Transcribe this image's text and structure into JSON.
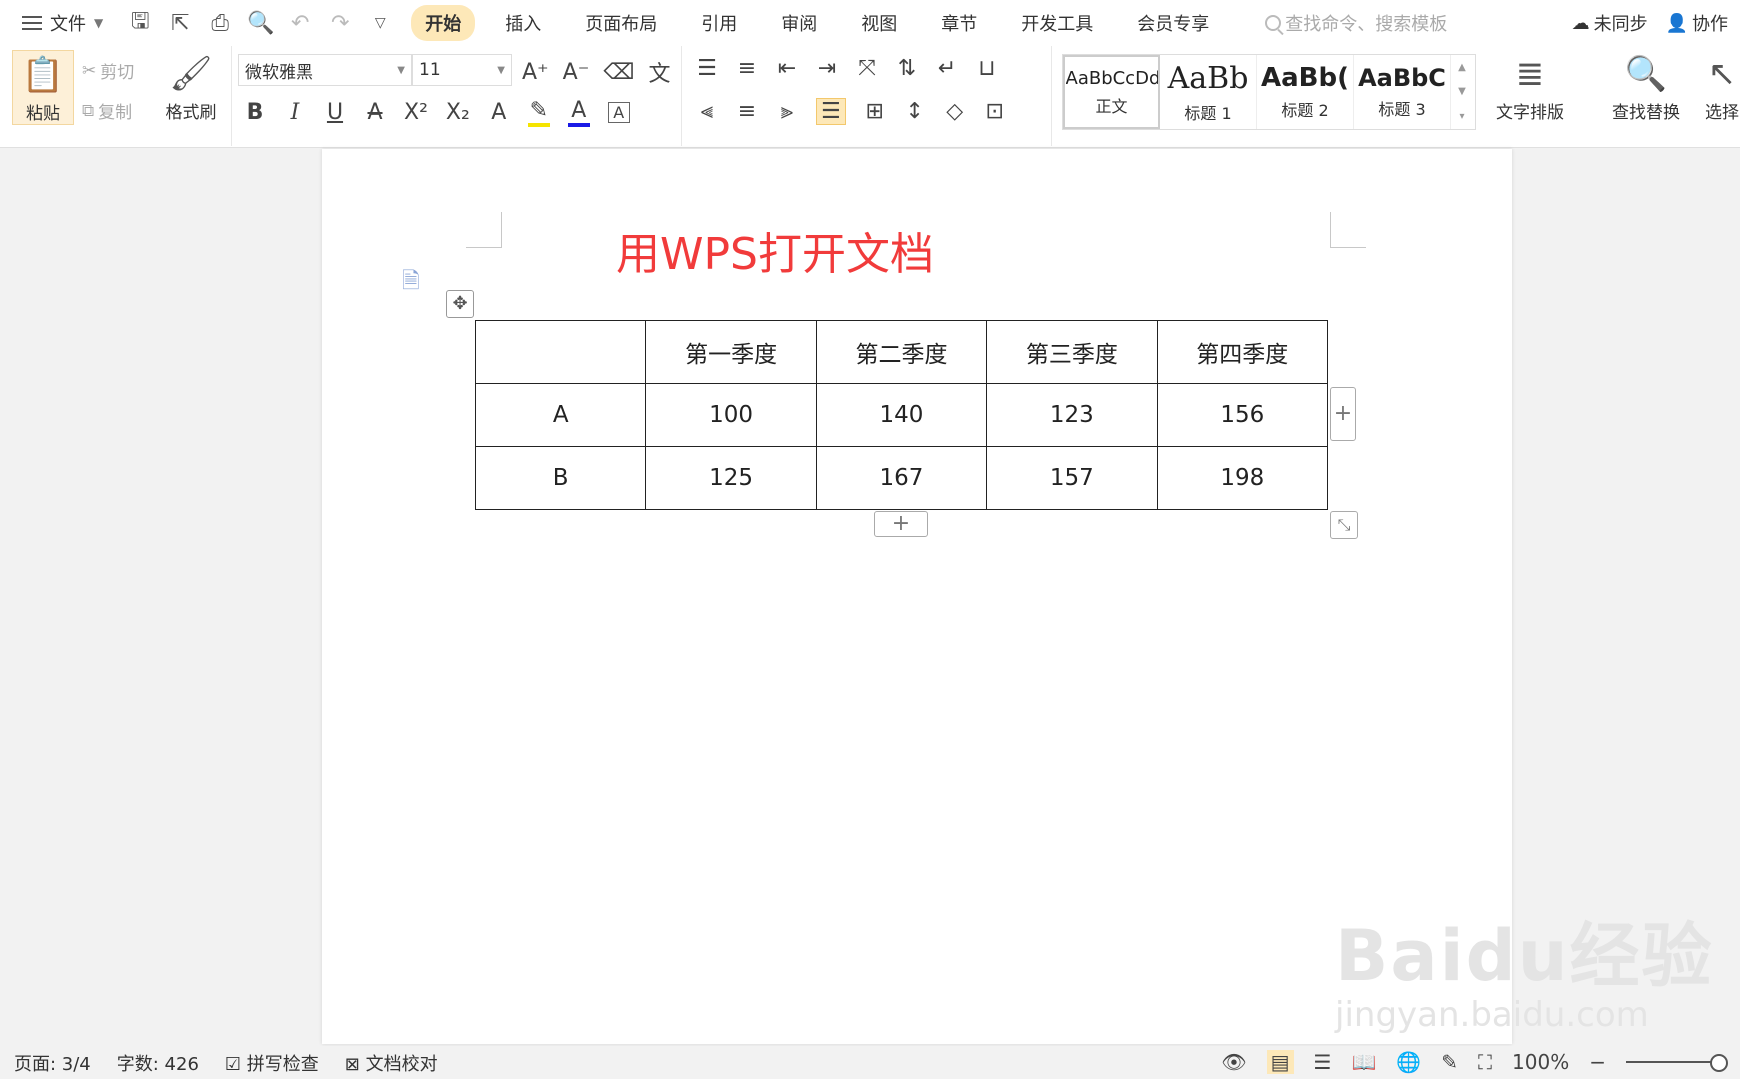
{
  "menubar": {
    "file_label": "文件",
    "tabs": [
      {
        "label": "开始",
        "active": true
      },
      {
        "label": "插入"
      },
      {
        "label": "页面布局"
      },
      {
        "label": "引用"
      },
      {
        "label": "审阅"
      },
      {
        "label": "视图"
      },
      {
        "label": "章节"
      },
      {
        "label": "开发工具"
      },
      {
        "label": "会员专享"
      }
    ],
    "search_placeholder": "查找命令、搜索模板",
    "sync_label": "未同步",
    "collab_label": "协作"
  },
  "ribbon": {
    "paste_label": "粘贴",
    "cut_label": "剪切",
    "copy_label": "复制",
    "format_painter_label": "格式刷",
    "font_name": "微软雅黑",
    "font_size": "11",
    "styles": [
      {
        "sample": "AaBbCcDd",
        "name": "正文"
      },
      {
        "sample": "AaBb",
        "name": "标题 1"
      },
      {
        "sample": "AaBb(",
        "name": "标题 2"
      },
      {
        "sample": "AaBbC",
        "name": "标题 3"
      }
    ],
    "text_layout_label": "文字排版",
    "find_replace_label": "查找替换",
    "select_label": "选择"
  },
  "document": {
    "title": "用WPS打开文档",
    "table": {
      "header": [
        "",
        "第一季度",
        "第二季度",
        "第三季度",
        "第四季度"
      ],
      "rows": [
        [
          "A",
          "100",
          "140",
          "123",
          "156"
        ],
        [
          "B",
          "125",
          "167",
          "157",
          "198"
        ]
      ]
    }
  },
  "watermark": {
    "brand": "Baidu经验",
    "url": "jingyan.baidu.com"
  },
  "statusbar": {
    "page": "页面: 3/4",
    "word_count": "字数: 426",
    "spell_check": "拼写检查",
    "doc_proof": "文档校对",
    "zoom": "100%"
  },
  "colors": {
    "active_tab_bg": "#fde8b8",
    "title_red": "#f13b3b"
  }
}
